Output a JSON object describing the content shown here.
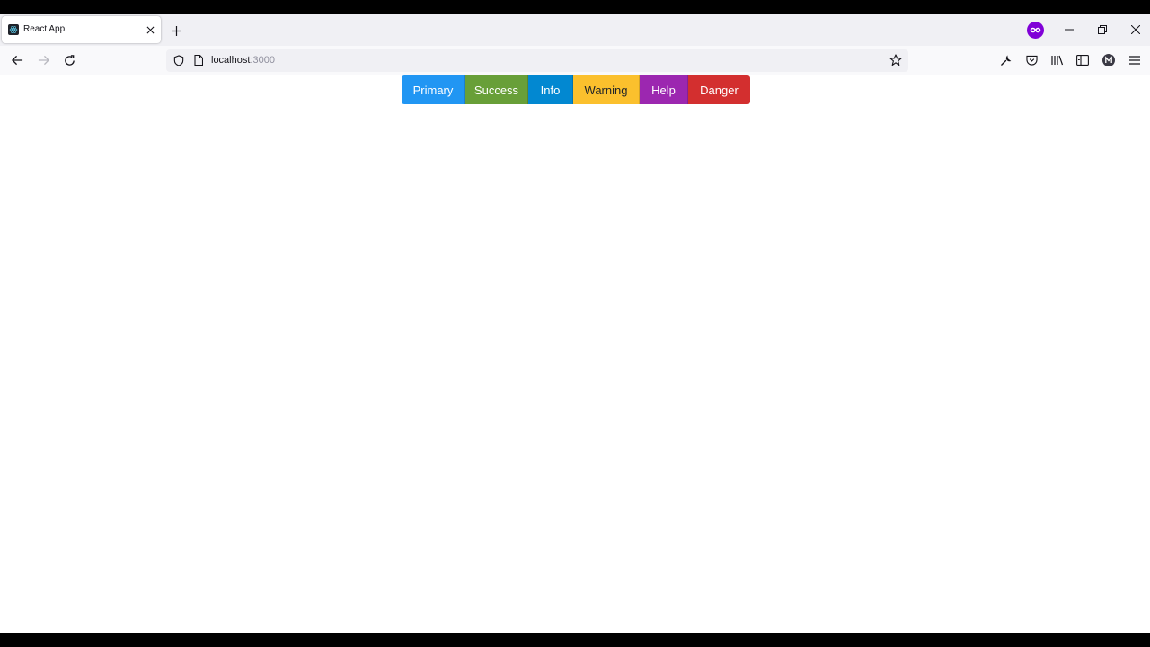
{
  "tab": {
    "title": "React App",
    "favicon": "react-icon"
  },
  "toolbar": {
    "extension_icon": "private-browsing-mask-icon"
  },
  "address": {
    "host": "localhost",
    "port": ":3000"
  },
  "buttons": [
    {
      "label": "Primary",
      "color": "#2196f3",
      "text_color": "#ffffff"
    },
    {
      "label": "Success",
      "color": "#689f38",
      "text_color": "#ffffff"
    },
    {
      "label": "Info",
      "color": "#0288d1",
      "text_color": "#ffffff"
    },
    {
      "label": "Warning",
      "color": "#fbc02d",
      "text_color": "#212529"
    },
    {
      "label": "Help",
      "color": "#9c27b0",
      "text_color": "#ffffff"
    },
    {
      "label": "Danger",
      "color": "#d32f2f",
      "text_color": "#ffffff"
    }
  ]
}
